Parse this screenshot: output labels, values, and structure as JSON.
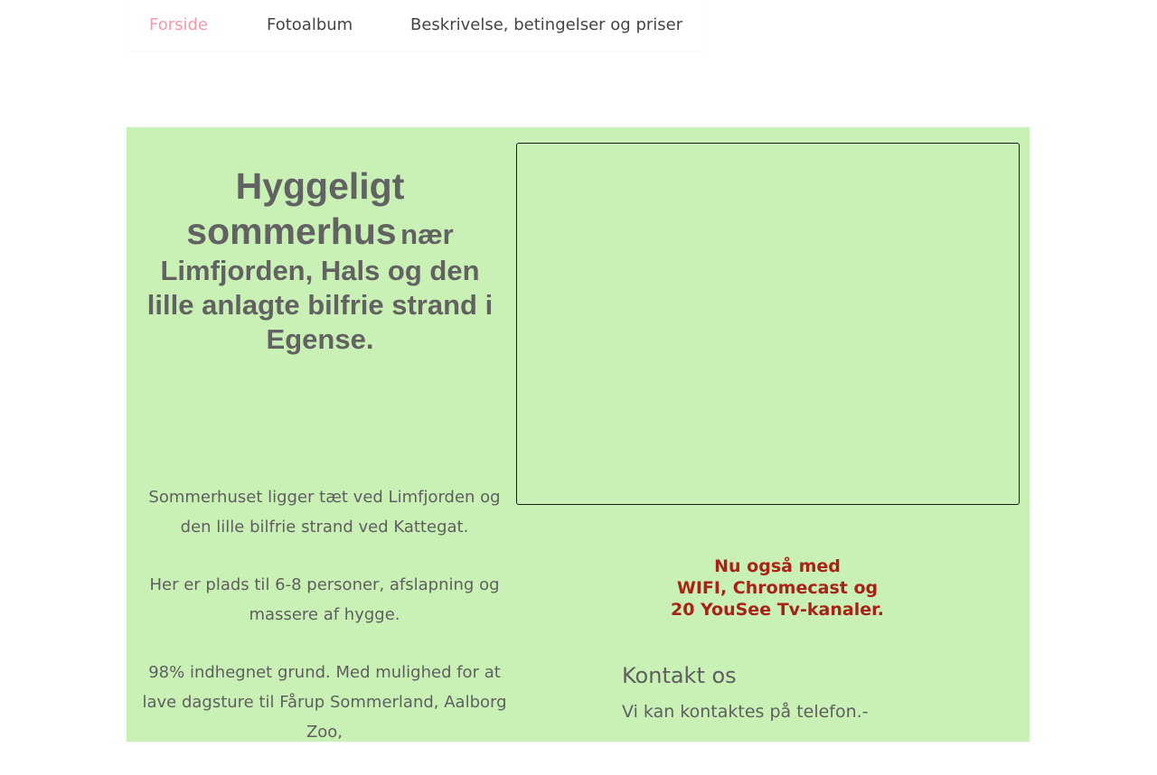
{
  "nav": {
    "items": [
      {
        "label": "Forside"
      },
      {
        "label": "Fotoalbum"
      },
      {
        "label": "Beskrivelse, betingelser og priser"
      }
    ]
  },
  "hero": {
    "title_big_1": "Hyggeligt",
    "title_big_2": "sommerhus",
    "title_small_1": "nær",
    "title_small_2": "Limfjorden, Hals og den lille anlagte bilfrie strand i Egense."
  },
  "intro": {
    "paragraphs": [
      "Sommerhuset ligger tæt ved Limfjorden og den lille bilfrie strand ved Kattegat.",
      "Her er plads til 6-8 personer, afslapning og massere af hygge.",
      "98% indhegnet grund. Med mulighed for at lave dagsture til Fårup Sommerland, Aalborg Zoo,"
    ]
  },
  "feature": {
    "line1": "Nu også med",
    "line2": "WIFI, Chromecast og",
    "line3": "20 YouSee Tv-kanaler."
  },
  "contact": {
    "title": "Kontakt os",
    "text": "Vi kan kontaktes på telefon.-"
  },
  "colors": {
    "panel_bg": "#c9f0b5",
    "nav_active": "#f29aa6",
    "feature_text": "#a82315"
  }
}
